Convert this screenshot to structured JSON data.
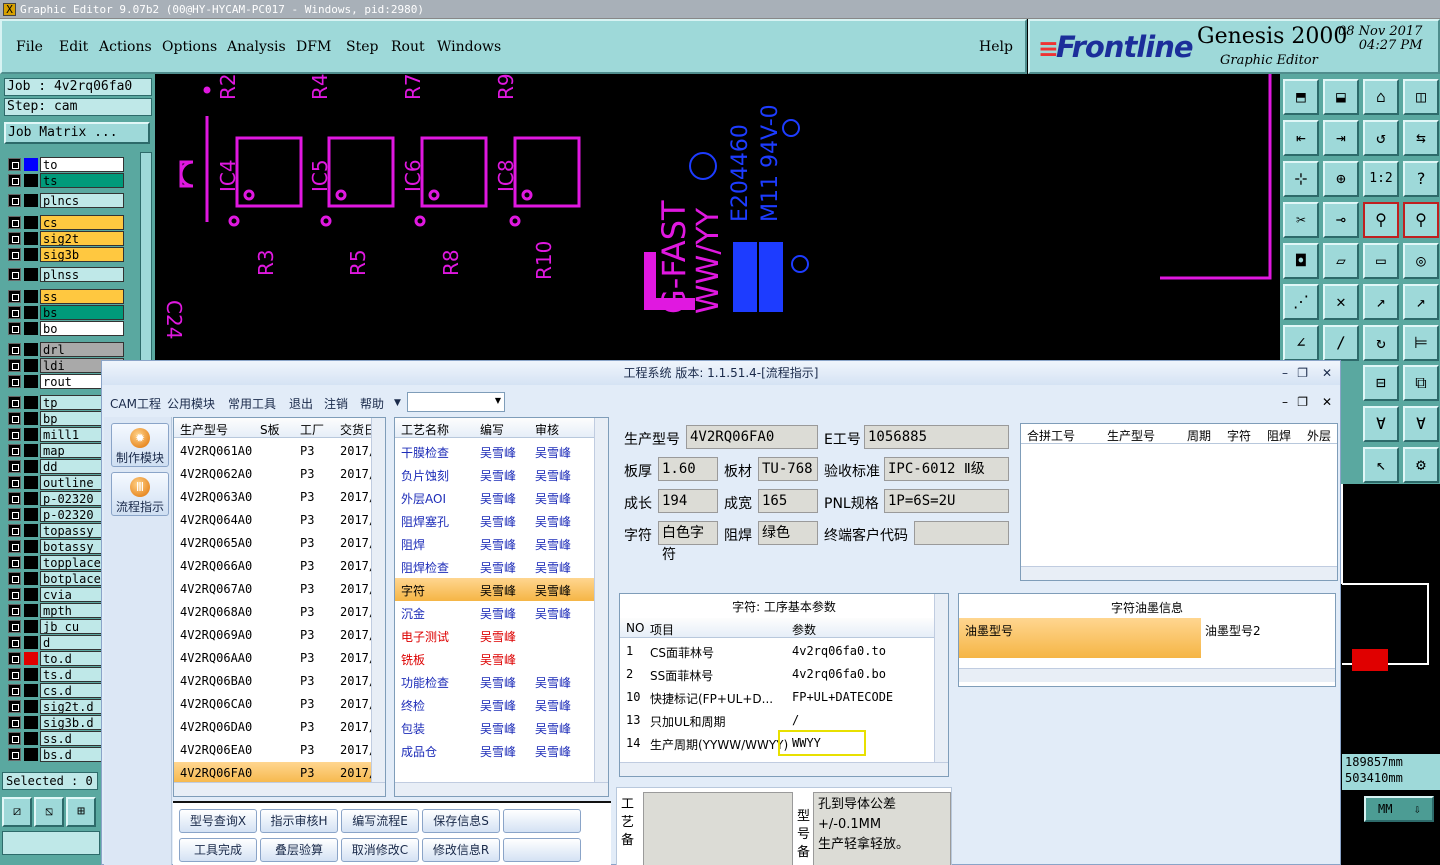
{
  "window": {
    "title": "Graphic Editor 9.07b2 (00@HY-HYCAM-PC017 - Windows, pid:2980)"
  },
  "menu": [
    "File",
    "Edit",
    "Actions",
    "Options",
    "Analysis",
    "DFM",
    "Step",
    "Rout",
    "Windows"
  ],
  "help": "Help",
  "brand": {
    "logo": "Frontline",
    "product": "Genesis 2000",
    "subtitle": "Graphic Editor",
    "date": "08 Nov 2017",
    "time": "04:27 PM"
  },
  "job": {
    "job": "Job : 4v2rq06fa0",
    "step": "Step: cam",
    "matrix": "Job Matrix ..."
  },
  "layers": [
    {
      "name": "to",
      "color": "#ffffff",
      "sw": "#0000ff"
    },
    {
      "name": "ts",
      "color": "#009a7a",
      "sw": "#000000"
    },
    {
      "name": "plncs",
      "color": "#bfe8e8",
      "sw": "#000000"
    },
    {
      "name": "cs",
      "color": "#ffc840",
      "sw": "#000000"
    },
    {
      "name": "sig2t",
      "color": "#ffc840",
      "sw": "#000000"
    },
    {
      "name": "sig3b",
      "color": "#ffc840",
      "sw": "#000000"
    },
    {
      "name": "plnss",
      "color": "#bfe8e8",
      "sw": "#000000"
    },
    {
      "name": "ss",
      "color": "#ffc840",
      "sw": "#000000"
    },
    {
      "name": "bs",
      "color": "#009a7a",
      "sw": "#000000"
    },
    {
      "name": "bo",
      "color": "#ffffff",
      "sw": "#000000"
    },
    {
      "name": "drl",
      "color": "#a9a9a9",
      "sw": "#000000"
    },
    {
      "name": "ldi",
      "color": "#a9a9a9",
      "sw": "#000000"
    },
    {
      "name": "rout",
      "color": "#ffffff",
      "sw": "#000000"
    },
    {
      "name": "tp",
      "color": "#bfe8e8",
      "sw": "#000000"
    },
    {
      "name": "bp",
      "color": "#bfe8e8",
      "sw": "#000000"
    },
    {
      "name": "mill1",
      "color": "#bfe8e8",
      "sw": "#000000"
    },
    {
      "name": "map",
      "color": "#bfe8e8",
      "sw": "#000000"
    },
    {
      "name": "dd",
      "color": "#bfe8e8",
      "sw": "#000000"
    },
    {
      "name": "outline",
      "color": "#bfe8e8",
      "sw": "#000000"
    },
    {
      "name": "p-02320_",
      "color": "#bfe8e8",
      "sw": "#000000"
    },
    {
      "name": "p-02320_",
      "color": "#bfe8e8",
      "sw": "#000000"
    },
    {
      "name": "topassy",
      "color": "#bfe8e8",
      "sw": "#000000"
    },
    {
      "name": "botassy",
      "color": "#bfe8e8",
      "sw": "#000000"
    },
    {
      "name": "topplace",
      "color": "#bfe8e8",
      "sw": "#000000"
    },
    {
      "name": "botplace",
      "color": "#bfe8e8",
      "sw": "#000000"
    },
    {
      "name": "cvia",
      "color": "#bfe8e8",
      "sw": "#000000"
    },
    {
      "name": "mpth",
      "color": "#bfe8e8",
      "sw": "#000000"
    },
    {
      "name": "jb_cu",
      "color": "#bfe8e8",
      "sw": "#000000"
    },
    {
      "name": "d",
      "color": "#bfe8e8",
      "sw": "#000000"
    },
    {
      "name": "to.d",
      "color": "#bfe8e8",
      "sw": "#e00000"
    },
    {
      "name": "ts.d",
      "color": "#bfe8e8",
      "sw": "#000000"
    },
    {
      "name": "cs.d",
      "color": "#bfe8e8",
      "sw": "#000000"
    },
    {
      "name": "sig2t.d",
      "color": "#bfe8e8",
      "sw": "#000000"
    },
    {
      "name": "sig3b.d",
      "color": "#bfe8e8",
      "sw": "#000000"
    },
    {
      "name": "ss.d",
      "color": "#bfe8e8",
      "sw": "#000000"
    },
    {
      "name": "bs.d",
      "color": "#bfe8e8",
      "sw": "#000000"
    }
  ],
  "selected": "Selected : 0",
  "canvas_labels": {
    "refs": [
      "IC4",
      "IC5",
      "IC6",
      "IC8",
      "R3",
      "R5",
      "R8",
      "R10",
      "C24",
      "R2",
      "R4",
      "R7",
      "R9"
    ],
    "brand_text": "G-FAST",
    "ww": "WW/YY",
    "ul": "E204460",
    "grade": "M11 94V-0"
  },
  "coords": {
    "x": "189857mm",
    "y": "503410mm"
  },
  "units": "MM",
  "dialog": {
    "title": "工程系统 版本: 1.1.51.4-[流程指示]",
    "menu": [
      "CAM工程",
      "公用模块",
      "常用工具",
      "退出",
      "注销",
      "帮助"
    ],
    "side": [
      "制作模块",
      "流程指示"
    ],
    "jobs_header": [
      "生产型号",
      "S板",
      "工厂",
      "交货日"
    ],
    "jobs": [
      [
        "4V2RQ061A0",
        "P3",
        "2017/"
      ],
      [
        "4V2RQ062A0",
        "P3",
        "2017/"
      ],
      [
        "4V2RQ063A0",
        "P3",
        "2017/"
      ],
      [
        "4V2RQ064A0",
        "P3",
        "2017/"
      ],
      [
        "4V2RQ065A0",
        "P3",
        "2017/"
      ],
      [
        "4V2RQ066A0",
        "P3",
        "2017/"
      ],
      [
        "4V2RQ067A0",
        "P3",
        "2017/"
      ],
      [
        "4V2RQ068A0",
        "P3",
        "2017/"
      ],
      [
        "4V2RQ069A0",
        "P3",
        "2017/"
      ],
      [
        "4V2RQ06AA0",
        "P3",
        "2017/"
      ],
      [
        "4V2RQ06BA0",
        "P3",
        "2017/"
      ],
      [
        "4V2RQ06CA0",
        "P3",
        "2017/"
      ],
      [
        "4V2RQ06DA0",
        "P3",
        "2017/"
      ],
      [
        "4V2RQ06EA0",
        "P3",
        "2017/"
      ],
      [
        "4V2RQ06FA0",
        "P3",
        "2017/"
      ]
    ],
    "proc_header": [
      "工艺名称",
      "编写",
      "审核"
    ],
    "procs": [
      [
        "干膜检查",
        "吴雪峰",
        "吴雪峰"
      ],
      [
        "负片蚀刻",
        "吴雪峰",
        "吴雪峰"
      ],
      [
        "外层AOI",
        "吴雪峰",
        "吴雪峰"
      ],
      [
        "阻焊塞孔",
        "吴雪峰",
        "吴雪峰"
      ],
      [
        "阻焊",
        "吴雪峰",
        "吴雪峰"
      ],
      [
        "阻焊检查",
        "吴雪峰",
        "吴雪峰"
      ],
      [
        "字符",
        "吴雪峰",
        "吴雪峰"
      ],
      [
        "沉金",
        "吴雪峰",
        "吴雪峰"
      ],
      [
        "电子测试",
        "吴雪峰",
        ""
      ],
      [
        "铣板",
        "吴雪峰",
        ""
      ],
      [
        "功能检查",
        "吴雪峰",
        "吴雪峰"
      ],
      [
        "终检",
        "吴雪峰",
        "吴雪峰"
      ],
      [
        "包装",
        "吴雪峰",
        "吴雪峰"
      ],
      [
        "成品仓",
        "吴雪峰",
        "吴雪峰"
      ]
    ],
    "info": {
      "model_lbl": "生产型号",
      "model": "4V2RQ06FA0",
      "e_lbl": "E工号",
      "e": "1056885",
      "thick_lbl": "板厚",
      "thick": "1.60",
      "mat_lbl": "板材",
      "mat": "TU-768",
      "std_lbl": "验收标准",
      "std": "IPC-6012 Ⅱ级",
      "len_lbl": "成长",
      "len": "194",
      "wid_lbl": "成宽",
      "wid": "165",
      "pnl_lbl": "PNL规格",
      "pnl": "1P=6S=2U",
      "char_lbl": "字符",
      "char": "白色字符",
      "mask_lbl": "阻焊",
      "mask": "绿色",
      "cust_lbl": "终端客户代码",
      "cust": ""
    },
    "merge_header": [
      "合拼工号",
      "生产型号",
      "周期",
      "字符",
      "阻焊",
      "外层"
    ],
    "params_title": "字符: 工序基本参数",
    "params_header": [
      "NO",
      "项目",
      "参数"
    ],
    "params": [
      [
        "1",
        "CS面菲林号",
        "4v2rq06fa0.to"
      ],
      [
        "2",
        "SS面菲林号",
        "4v2rq06fa0.bo"
      ],
      [
        "10",
        "快捷标记(FP+UL+D...",
        "FP+UL+DATECODE"
      ],
      [
        "13",
        "只加UL和周期",
        "/"
      ],
      [
        "14",
        "生产周期(YYWW/WWYY)",
        "WWYY"
      ]
    ],
    "ink_title": "字符油墨信息",
    "ink_header": [
      "油墨型号",
      "油墨型号2"
    ],
    "buttons": [
      [
        "型号查询X",
        "指示审核H",
        "编写流程E",
        "保存信息S",
        ""
      ],
      [
        "工具完成",
        "叠层验算",
        "取消修改C",
        "修改信息R",
        ""
      ]
    ],
    "notes_lbl": "工艺备",
    "model_lbl2": "型号备",
    "note": "孔到导体公差+/-0.1MM\n生产轻拿轻放。"
  }
}
